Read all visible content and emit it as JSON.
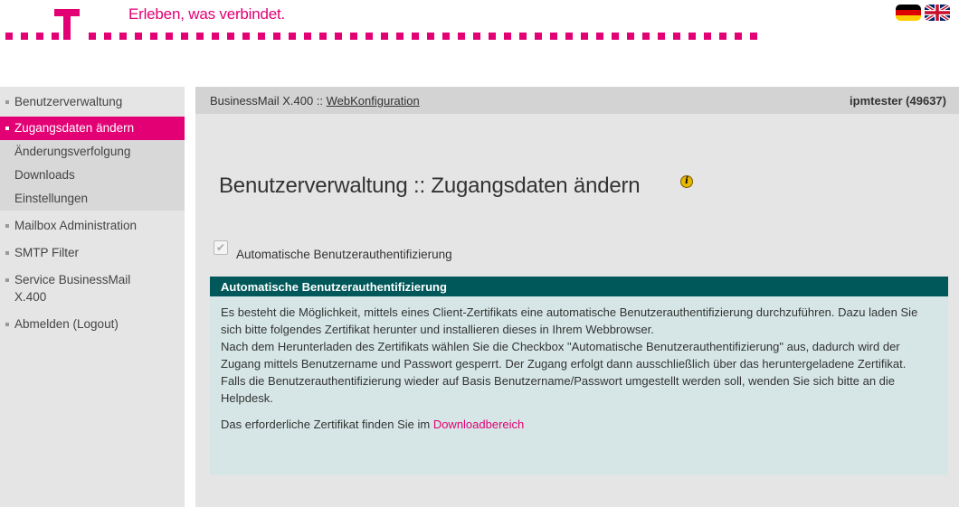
{
  "header": {
    "slogan": "Erleben, was verbindet.",
    "logo": "telekom-t-logo",
    "brand_color": "#e20074",
    "languages": [
      {
        "name": "german-flag-icon",
        "label": "Deutsch"
      },
      {
        "name": "uk-flag-icon",
        "label": "English"
      }
    ]
  },
  "sidebar": {
    "items": [
      {
        "label": "Benutzerverwaltung",
        "type": "top"
      },
      {
        "label": "Zugangsdaten ändern",
        "type": "active"
      },
      {
        "label": "Änderungsverfolgung",
        "type": "sub"
      },
      {
        "label": "Downloads",
        "type": "sub"
      },
      {
        "label": "Einstellungen",
        "type": "sub"
      },
      {
        "label": "Mailbox Administration",
        "type": "top"
      },
      {
        "label": "SMTP Filter",
        "type": "top"
      },
      {
        "label": "Service BusinessMail X.400",
        "type": "top"
      },
      {
        "label": "Abmelden (Logout)",
        "type": "top"
      }
    ]
  },
  "breadcrumb": {
    "prefix": "BusinessMail X.400 :: ",
    "link": "WebKonfiguration"
  },
  "user": {
    "label": "ipmtester (49637)"
  },
  "main": {
    "title": "Benutzerverwaltung :: Zugangsdaten ändern",
    "checkbox_label": "Automatische Benutzerauthentifizierung",
    "checkbox_checked": true,
    "panel": {
      "title": "Automatische Benutzerauthentifizierung",
      "para1": "Es besteht die Möglichkeit, mittels eines Client-Zertifikats eine automatische Benutzerauthentifizierung durchzuführen. Dazu laden Sie sich bitte folgendes Zertifikat herunter und installieren dieses in Ihrem Webbrowser.",
      "para2": "Nach dem Herunterladen des Zertifikats wählen Sie die Checkbox \"Automatische Benutzerauthentifizierung\" aus, dadurch wird der Zugang mittels Benutzername und Passwort gesperrt. Der Zugang erfolgt dann ausschließlich über das heruntergeladene Zertifikat.",
      "para3": "Falls die Benutzerauthentifizierung wieder auf Basis Benutzername/Passwort umgestellt werden soll, wenden Sie sich bitte an die Helpdesk.",
      "para4_prefix": "Das erforderliche Zertifikat finden Sie im ",
      "para4_link": "Downloadbereich"
    }
  }
}
